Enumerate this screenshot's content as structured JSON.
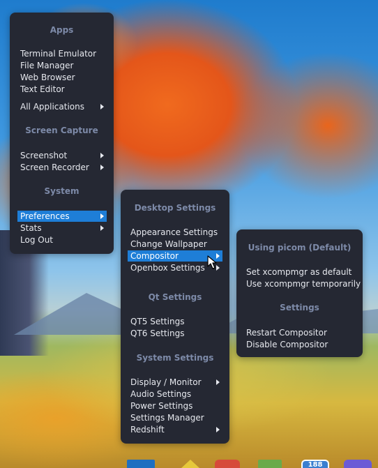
{
  "main_menu": {
    "sections": {
      "apps": "Apps",
      "screen_capture": "Screen Capture",
      "system": "System"
    },
    "items": {
      "terminal": "Terminal Emulator",
      "file_manager": "File Manager",
      "web_browser": "Web Browser",
      "text_editor": "Text Editor",
      "all_apps": "All Applications",
      "screenshot": "Screenshot",
      "screen_recorder": "Screen Recorder",
      "preferences": "Preferences",
      "stats": "Stats",
      "log_out": "Log Out"
    }
  },
  "preferences_menu": {
    "sections": {
      "desktop": "Desktop Settings",
      "qt": "Qt Settings",
      "system": "System Settings"
    },
    "items": {
      "appearance": "Appearance Settings",
      "wallpaper": "Change Wallpaper",
      "compositor": "Compositor",
      "openbox": "Openbox Settings",
      "qt5": "QT5 Settings",
      "qt6": "QT6 Settings",
      "display": "Display / Monitor",
      "audio": "Audio Settings",
      "power": "Power Settings",
      "settings_manager": "Settings Manager",
      "redshift": "Redshift"
    }
  },
  "compositor_menu": {
    "sections": {
      "using": "Using picom (Default)",
      "settings": "Settings"
    },
    "items": {
      "set_default": "Set xcompmgr as default",
      "use_temp": "Use xcompmgr temporarily",
      "restart": "Restart Compositor",
      "disable": "Disable Compositor"
    }
  },
  "dock": {
    "badge": "188"
  },
  "colors": {
    "menu_bg": "#252833",
    "header_text": "#7d8aa8",
    "selection": "#1e7ed7"
  }
}
